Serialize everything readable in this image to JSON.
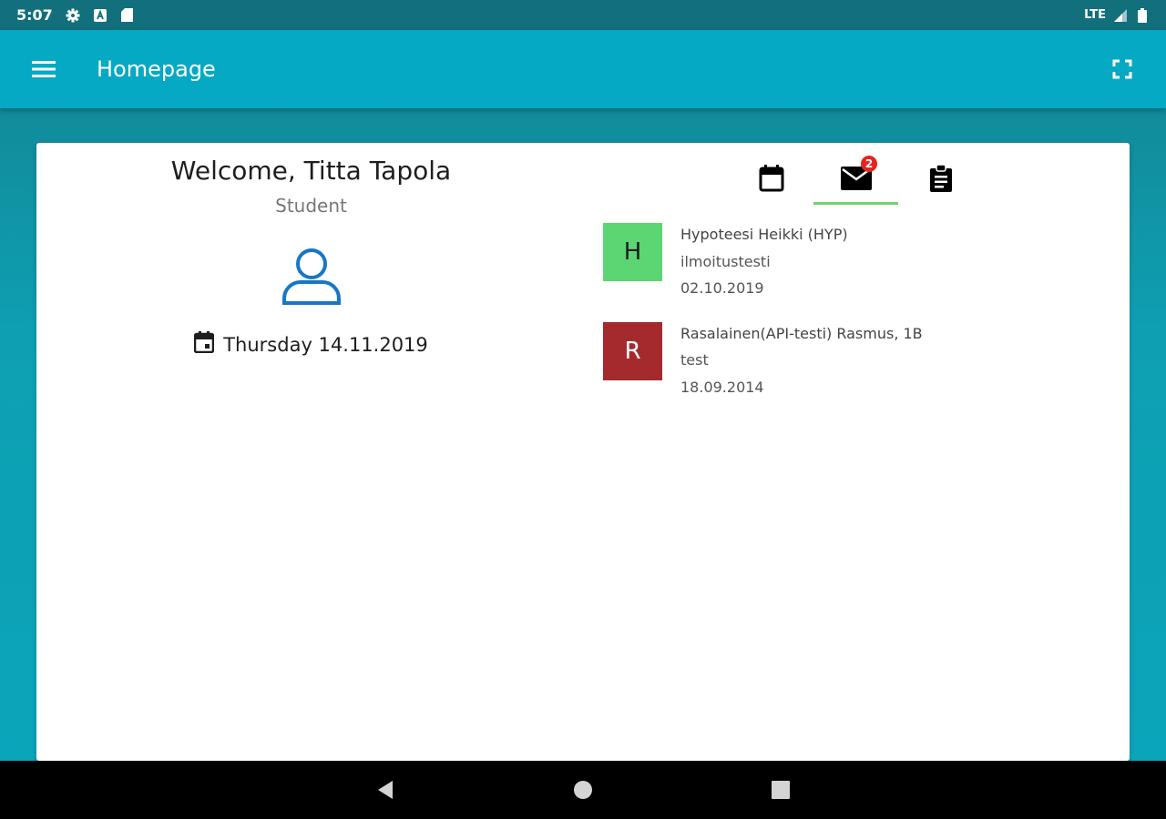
{
  "status_bar": {
    "time": "5:07",
    "network": "LTE",
    "icons": [
      "gear-icon",
      "a-box-icon",
      "sd-card-icon",
      "signal-icon",
      "battery-icon"
    ]
  },
  "app_bar": {
    "title": "Homepage",
    "menu_icon": "hamburger-menu-icon",
    "fullscreen_icon": "fullscreen-icon",
    "color": "#05a9c4"
  },
  "profile": {
    "welcome": "Welcome, Titta Tapola",
    "role": "Student",
    "date": "Thursday 14.11.2019",
    "avatar_icon": "person-outline-icon",
    "avatar_color": "#1877c5"
  },
  "tabs": [
    {
      "icon": "calendar-icon",
      "badge": null,
      "active": false
    },
    {
      "icon": "mail-icon",
      "badge": "2",
      "active": true
    },
    {
      "icon": "clipboard-icon",
      "badge": null,
      "active": false
    }
  ],
  "messages": [
    {
      "initial": "H",
      "color": "#5cd573",
      "text_color": "#1e1e1e",
      "sender": "Hypoteesi Heikki (HYP)",
      "subject": "ilmoitustesti",
      "date": "02.10.2019"
    },
    {
      "initial": "R",
      "color": "#a52a2e",
      "text_color": "#ffffff",
      "sender": "Rasalainen(API-testi) Rasmus, 1B",
      "subject": "test",
      "date": "18.09.2014"
    }
  ],
  "nav_bar": {
    "buttons": [
      "back-icon",
      "home-icon",
      "recents-icon"
    ]
  }
}
